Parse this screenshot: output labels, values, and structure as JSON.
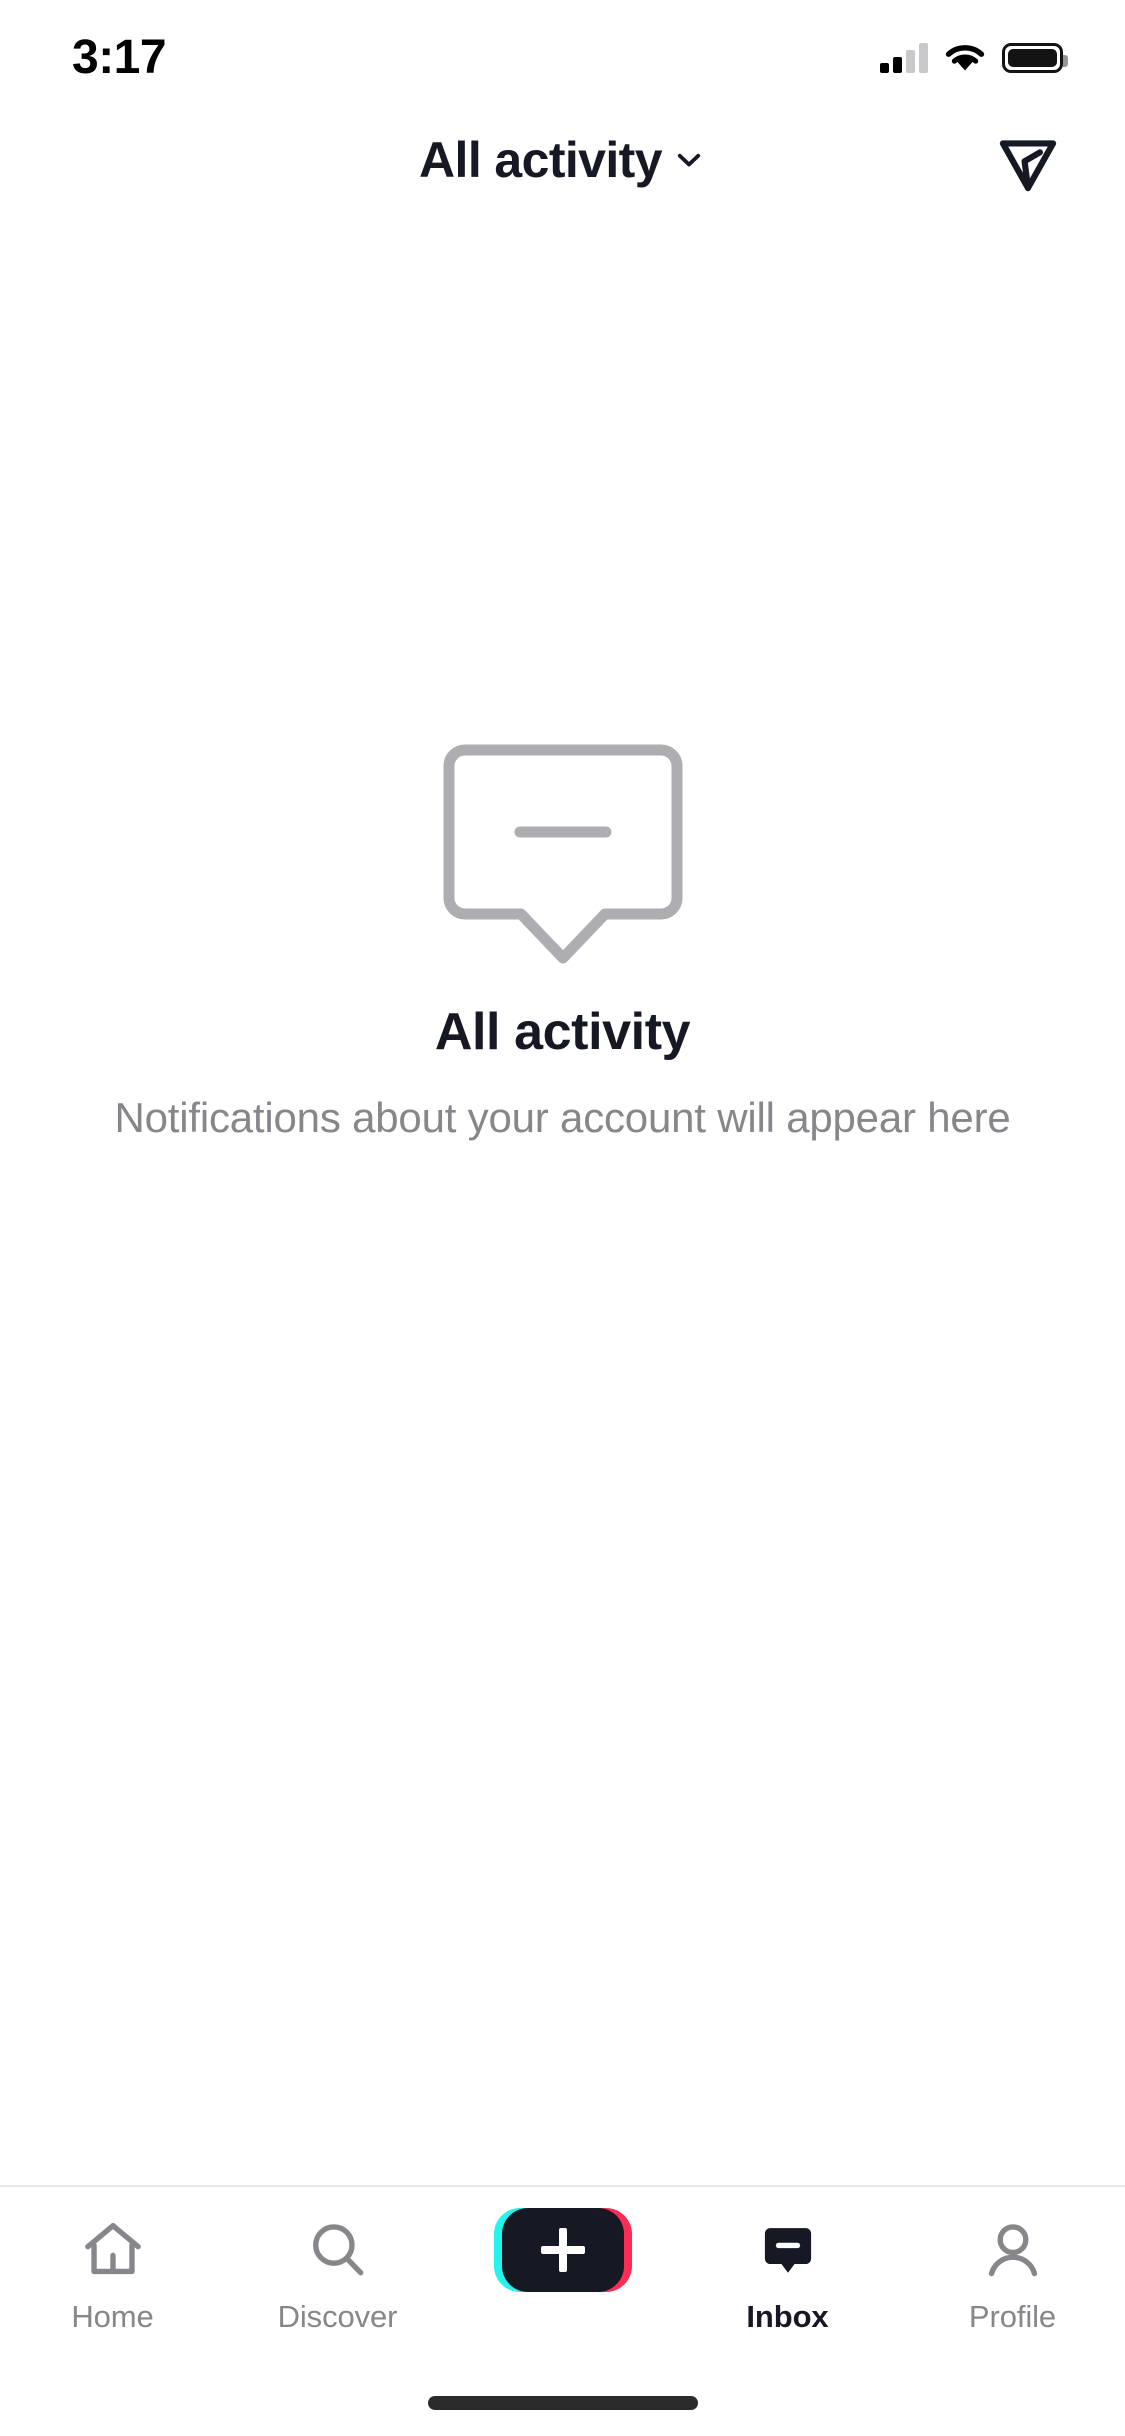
{
  "status_bar": {
    "time": "3:17",
    "signal_icon": "cellular-signal-icon",
    "wifi_icon": "wifi-icon",
    "battery_icon": "battery-icon"
  },
  "header": {
    "title": "All activity",
    "dropdown_icon": "chevron-down-icon",
    "share_icon": "send-message-icon"
  },
  "empty_state": {
    "icon": "speech-bubble-icon",
    "title": "All activity",
    "subtitle": "Notifications about your account will appear here"
  },
  "bottom_nav": {
    "items": [
      {
        "label": "Home",
        "icon": "home-icon",
        "active": false
      },
      {
        "label": "Discover",
        "icon": "search-icon",
        "active": false
      },
      {
        "label": "",
        "icon": "create-plus-icon",
        "active": false
      },
      {
        "label": "Inbox",
        "icon": "inbox-bubble-icon",
        "active": true
      },
      {
        "label": "Profile",
        "icon": "person-icon",
        "active": false
      }
    ]
  },
  "colors": {
    "text_primary": "#161823",
    "text_secondary": "#86878B",
    "empty_icon": "#adadb2",
    "accent_cyan": "#25F4EE",
    "accent_pink": "#FE2C55",
    "divider": "#e9e9ec",
    "background": "#FFFFFF"
  }
}
